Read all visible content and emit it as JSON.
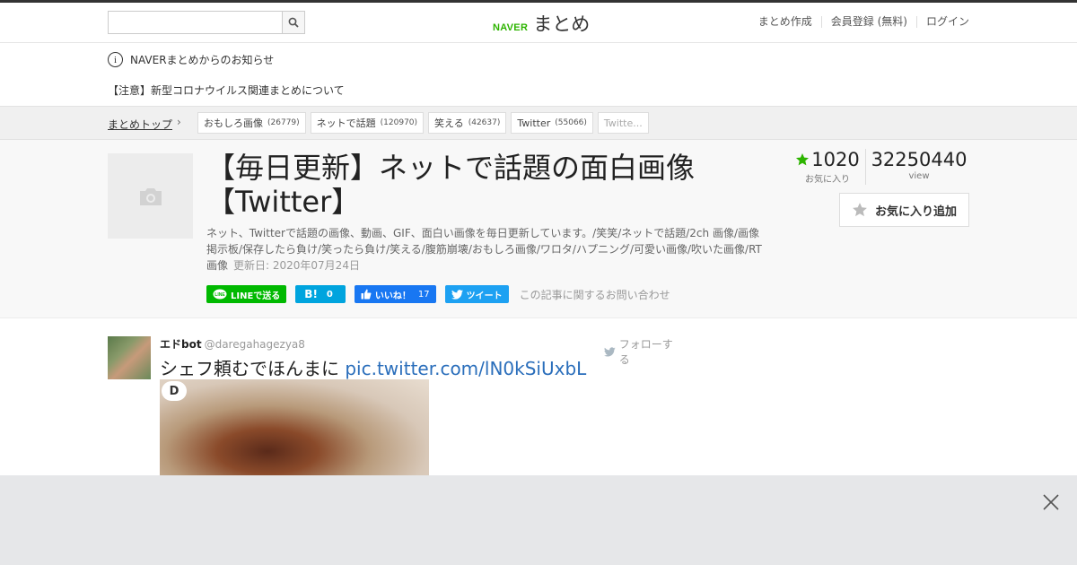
{
  "header": {
    "search": {
      "value": "",
      "placeholder": ""
    },
    "logo": {
      "brand": "NAVER",
      "name": "まとめ"
    },
    "nav": [
      "まとめ作成",
      "会員登録 (無料)",
      "ログイン"
    ]
  },
  "notice": {
    "title": "NAVERまとめからのお知らせ",
    "item": "【注意】新型コロナウイルス関連まとめについて"
  },
  "breadcrumb": {
    "top_label": "まとめトップ"
  },
  "tags": [
    {
      "label": "おもしろ画像",
      "count": "(26779)"
    },
    {
      "label": "ネットで話題",
      "count": "(120970)"
    },
    {
      "label": "笑える",
      "count": "(42637)"
    },
    {
      "label": "Twitter",
      "count": "(55066)"
    },
    {
      "label": "Twitte...",
      "count": ""
    }
  ],
  "article": {
    "title": "【毎日更新】ネットで話題の面白画像【Twitter】",
    "description": "ネット、Twitterで話題の画像、動画、GIF、面白い画像を毎日更新しています。/笑笑/ネットで話題/2ch 画像/画像掲示板/保存したら負け/笑ったら負け/笑える/腹筋崩壊/おもしろ画像/ワロタ/ハプニング/可愛い画像/吹いた画像/RT画像",
    "updated": "更新日: 2020年07月24日",
    "favorites": {
      "count": "1020",
      "label": "お気に入り"
    },
    "views": {
      "count": "32250440",
      "label": "view"
    },
    "fav_button": "お気に入り追加",
    "share": {
      "line": "LINEで送る",
      "hatena_count": "0",
      "fb_like": "いいね！",
      "fb_count": "17",
      "tweet": "ツイート"
    },
    "inquiry": "この記事に関するお問い合わせ"
  },
  "tweet": {
    "name": "エドbot",
    "handle": "@daregahagezya8",
    "follow": "フォローする",
    "text": "シェフ頼むでほんまに",
    "link": "pic.twitter.com/lN0kSiUxbL"
  },
  "colors": {
    "naver_green": "#2db400",
    "link_blue": "#2a6ebb",
    "facebook": "#1877f2",
    "twitter": "#1da1f2",
    "hatena": "#00a4de",
    "line": "#00b900"
  }
}
